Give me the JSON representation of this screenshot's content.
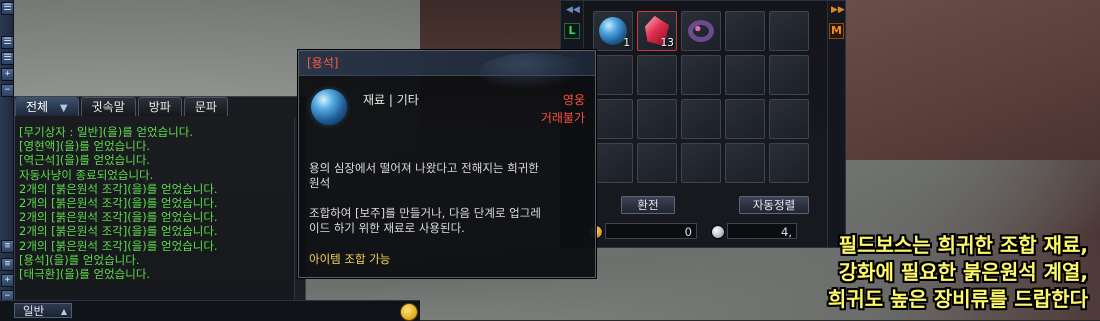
{
  "chat": {
    "tabs": [
      {
        "label": "전체",
        "active": true
      },
      {
        "label": "귓속말",
        "active": false
      },
      {
        "label": "방파",
        "active": false
      },
      {
        "label": "문파",
        "active": false
      }
    ],
    "filter_icon": "funnel-icon",
    "lines": [
      "[무기상자 : 일반](을)를 얻었습니다.",
      "[영현액](을)를 얻었습니다.",
      "[역근석](을)를 얻었습니다.",
      "자동사냥이 종료되었습니다.",
      "2개의 [붉은원석 조각](을)를 얻었습니다.",
      "2개의 [붉은원석 조각](을)를 얻었습니다.",
      "2개의 [붉은원석 조각](을)를 얻었습니다.",
      "2개의 [붉은원석 조각](을)를 얻었습니다.",
      "2개의 [붉은원석 조각](을)를 얻었습니다.",
      "[용석](을)를 얻었습니다.",
      "[태극환](을)를 얻었습니다."
    ],
    "mode_label": "일반",
    "text_color": "#5fdc4c"
  },
  "sidebar": {
    "buttons": [
      "☰",
      "☰",
      "☰",
      "+",
      "−"
    ]
  },
  "inventory": {
    "left_badge": "L",
    "right_badge": "M",
    "items": [
      {
        "icon": "blue-gem-icon",
        "count": "1"
      },
      {
        "icon": "red-crystal-icon",
        "count": "13"
      },
      {
        "icon": "ring-icon",
        "count": ""
      }
    ],
    "sort_button": "환전",
    "auto_sort_button": "자동정렬",
    "gold": "0",
    "silver": "4,"
  },
  "tooltip": {
    "title": "[용석]",
    "category": "재료 | 기타",
    "bind": "영웅",
    "trade": "거래불가",
    "description": "용의 심장에서 떨어져 나왔다고 전해지는 희귀한\n원석",
    "usage": "조합하여 [보주]를 만들거나, 다음 단계로 업그레\n이드 하기 위한 재료로 사용된다.",
    "craft": "아이템 조합 가능",
    "title_color": "#ff5a4a",
    "bind_color": "#ff4d3d",
    "craft_color": "#f2d45a"
  },
  "caption": {
    "lines": [
      "필드보스는 희귀한 조합 재료,",
      "강화에 필요한 붉은원석 계열,",
      "희귀도 높은 장비류를 드랍한다"
    ],
    "color": "#fff86a"
  }
}
